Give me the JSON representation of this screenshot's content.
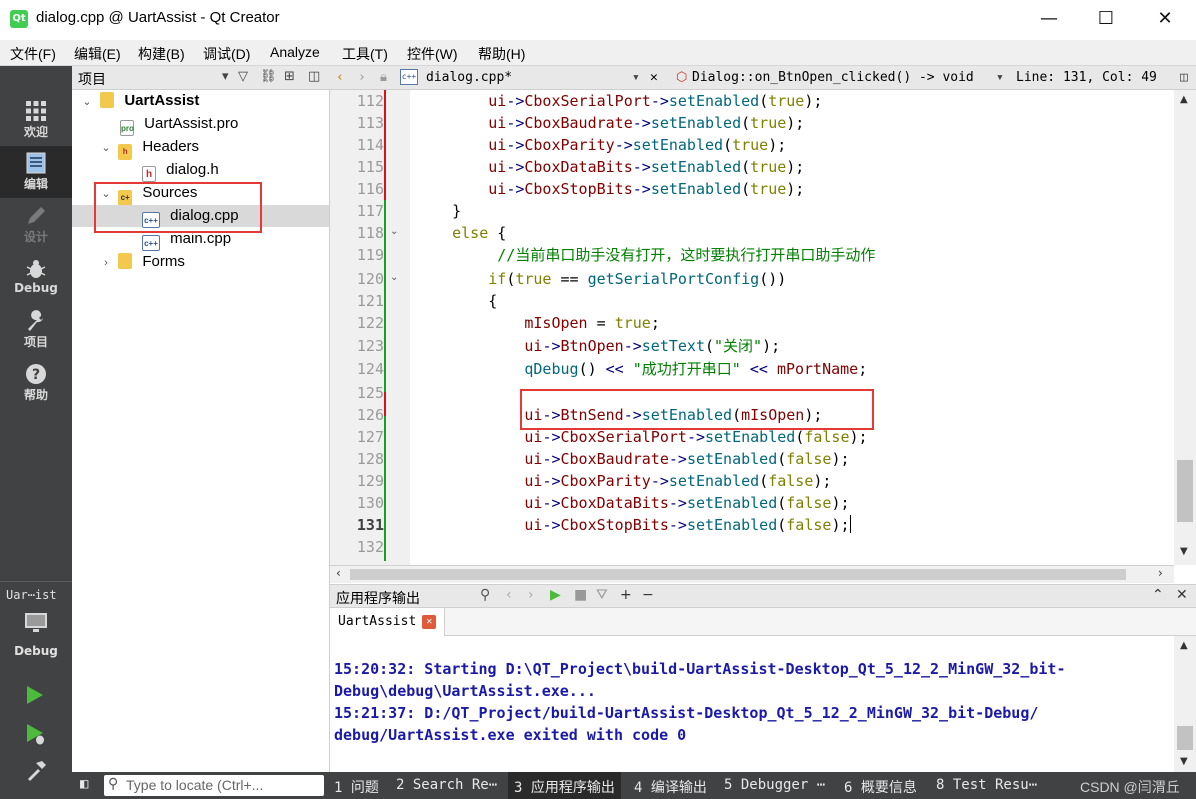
{
  "window": {
    "title": "dialog.cpp @ UartAssist - Qt Creator",
    "logo_text": "Qt"
  },
  "menu": [
    "文件(F)",
    "编辑(E)",
    "构建(B)",
    "调试(D)",
    "Analyze",
    "工具(T)",
    "控件(W)",
    "帮助(H)"
  ],
  "modes": [
    {
      "label": "欢迎",
      "icon": "grid-icon"
    },
    {
      "label": "编辑",
      "icon": "edit-doc-icon"
    },
    {
      "label": "设计",
      "icon": "pencil-icon"
    },
    {
      "label": "Debug",
      "icon": "bug-icon"
    },
    {
      "label": "项目",
      "icon": "wrench-icon"
    },
    {
      "label": "帮助",
      "icon": "help-icon"
    }
  ],
  "kit": {
    "project": "Uar⋯ist",
    "build": "Debug"
  },
  "projects": {
    "header_title": "项目",
    "root": "UartAssist",
    "pro_file": "UartAssist.pro",
    "headers": "Headers",
    "header_file": "dialog.h",
    "sources": "Sources",
    "source_file1": "dialog.cpp",
    "source_file2": "main.cpp",
    "forms": "Forms"
  },
  "editor_toolbar": {
    "file": "dialog.cpp*",
    "symbol": "Dialog::on_BtnOpen_clicked() -> void",
    "position": "Line: 131, Col: 49"
  },
  "line_numbers": [
    "112",
    "113",
    "114",
    "115",
    "116",
    "117",
    "118",
    "119",
    "120",
    "121",
    "122",
    "123",
    "124",
    "125",
    "126",
    "127",
    "128",
    "129",
    "130",
    "131",
    "132"
  ],
  "output": {
    "pane_title": "应用程序输出",
    "tab": "UartAssist",
    "lines": [
      "15:20:32: Starting D:\\QT_Project\\build-UartAssist-Desktop_Qt_5_12_2_MinGW_32_bit-",
      "Debug\\debug\\UartAssist.exe...",
      "15:21:37: D:/QT_Project/build-UartAssist-Desktop_Qt_5_12_2_MinGW_32_bit-Debug/",
      "debug/UartAssist.exe exited with code 0"
    ]
  },
  "status": {
    "locator_placeholder": "Type to locate (Ctrl+...",
    "tabs": [
      "1 问题",
      "2 Search Re⋯",
      "3 应用程序输出",
      "4 编译输出",
      "5 Debugger ⋯",
      "6 概要信息",
      "8 Test Resu⋯"
    ],
    "watermark": "CSDN @闫渭丘"
  }
}
